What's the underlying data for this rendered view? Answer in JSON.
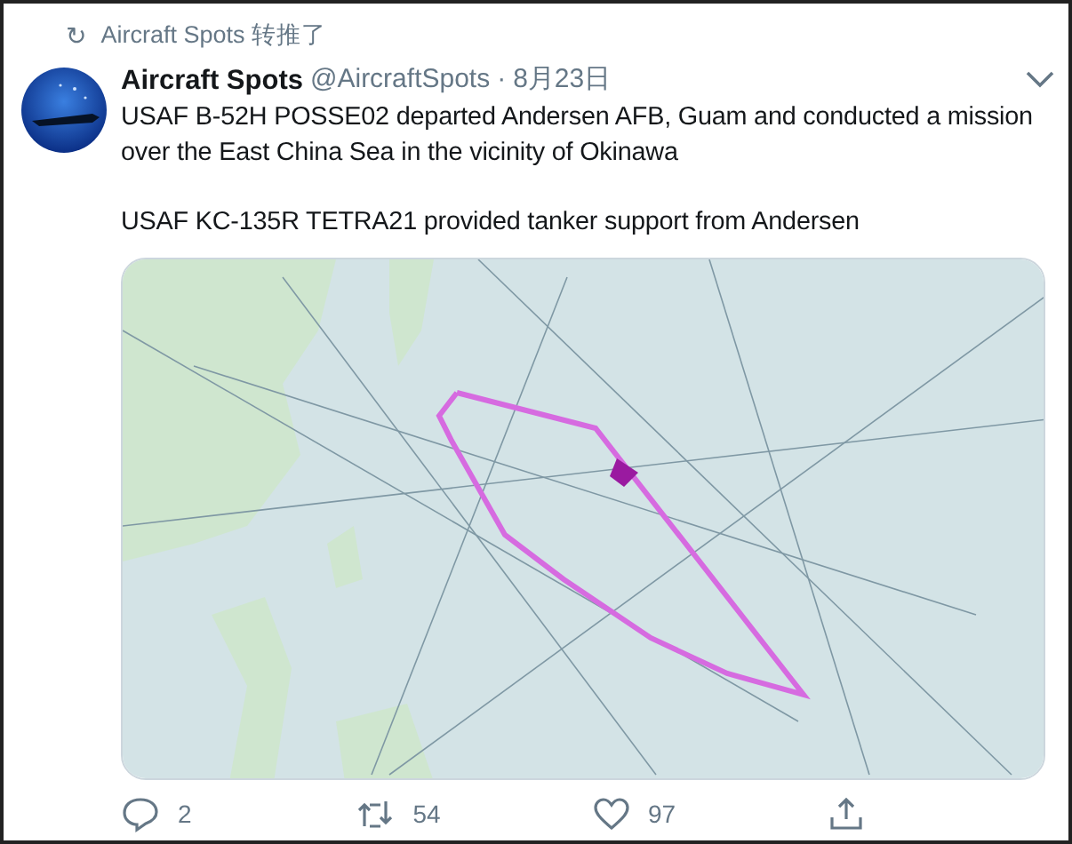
{
  "retweet_header": {
    "icon": "↻",
    "text": "Aircraft Spots 转推了"
  },
  "tweet": {
    "display_name": "Aircraft Spots",
    "handle": "@AircraftSpots",
    "separator": "·",
    "date": "8月23日",
    "paragraphs": [
      "USAF B-52H POSSE02 departed Andersen AFB, Guam and conducted a mission over the East China Sea in the vicinity of Okinawa",
      "USAF KC-135R TETRA21 provided tanker support from Andersen"
    ],
    "actions": [
      {
        "kind": "reply",
        "count": "2"
      },
      {
        "kind": "retweet",
        "count": "54"
      },
      {
        "kind": "like",
        "count": "97"
      },
      {
        "kind": "share"
      }
    ]
  }
}
